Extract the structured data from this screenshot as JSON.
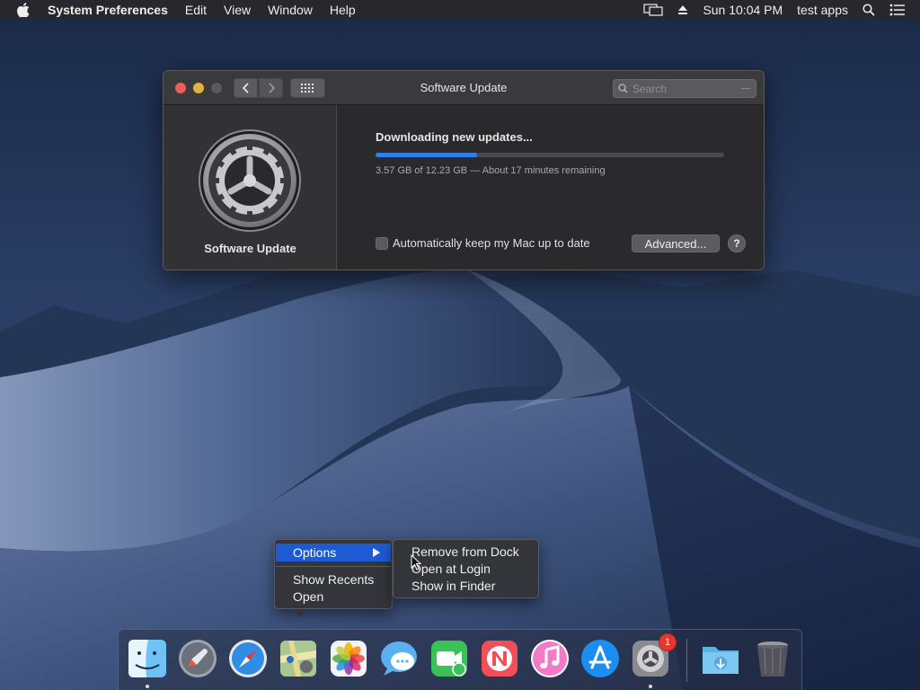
{
  "menubar": {
    "app_name": "System Preferences",
    "items": [
      "Edit",
      "View",
      "Window",
      "Help"
    ],
    "clock": "Sun 10:04 PM",
    "user": "test apps",
    "icons": [
      "apple-icon",
      "display-mirroring-icon",
      "eject-icon",
      "spotlight-search-icon",
      "notification-center-icon"
    ]
  },
  "window": {
    "title": "Software Update",
    "search_placeholder": "Search",
    "pane_label": "Software Update",
    "download_title": "Downloading new updates...",
    "progress_fraction": 0.29,
    "progress_color": "#2f7ff0",
    "status_text": "3.57 GB of 12.23 GB — About 17 minutes remaining",
    "auto_update_label": "Automatically keep my Mac up to date",
    "auto_update_checked": false,
    "advanced_label": "Advanced...",
    "help_label": "?"
  },
  "context_menu": {
    "options_label": "Options",
    "show_recents_label": "Show Recents",
    "open_label": "Open",
    "highlight_color": "#1e5ad3"
  },
  "submenu": {
    "remove_label": "Remove from Dock",
    "open_login_label": "Open at Login",
    "show_finder_label": "Show in Finder"
  },
  "dock": {
    "items": [
      {
        "name": "Finder",
        "icon": "finder-icon",
        "running": true
      },
      {
        "name": "Launchpad",
        "icon": "launchpad-icon",
        "running": false
      },
      {
        "name": "Safari",
        "icon": "safari-icon",
        "running": false
      },
      {
        "name": "Maps",
        "icon": "maps-icon",
        "running": false
      },
      {
        "name": "Photos",
        "icon": "photos-icon",
        "running": false
      },
      {
        "name": "Messages",
        "icon": "messages-icon",
        "running": false
      },
      {
        "name": "FaceTime",
        "icon": "facetime-icon",
        "running": false
      },
      {
        "name": "News",
        "icon": "news-icon",
        "running": false
      },
      {
        "name": "iTunes",
        "icon": "itunes-icon",
        "running": false
      },
      {
        "name": "App Store",
        "icon": "app-store-icon",
        "running": false
      },
      {
        "name": "System Preferences",
        "icon": "system-preferences-icon",
        "running": true,
        "badge": "1"
      },
      {
        "name": "Downloads",
        "icon": "downloads-folder-icon",
        "running": false
      },
      {
        "name": "Trash",
        "icon": "trash-icon",
        "running": false
      }
    ]
  }
}
